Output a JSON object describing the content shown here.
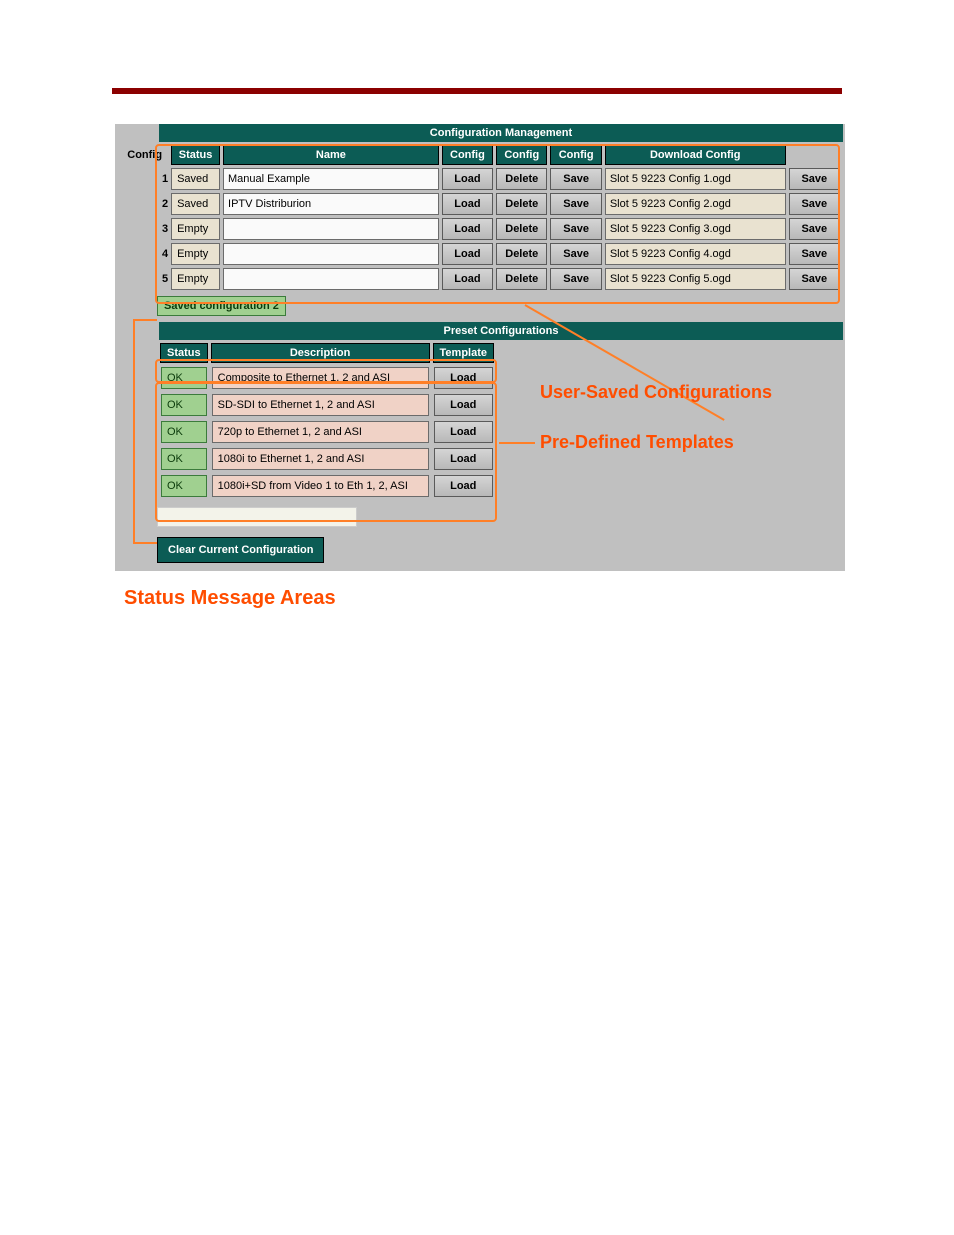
{
  "section_titles": {
    "config_mgmt": "Configuration Management",
    "preset": "Preset Configurations"
  },
  "config_headers": [
    "Config",
    "Status",
    "Name",
    "Config",
    "Config",
    "Config",
    "Download Config"
  ],
  "config_rows": [
    {
      "num": "1",
      "status": "Saved",
      "name": "Manual Example",
      "dl": "Slot 5 9223 Config 1.ogd"
    },
    {
      "num": "2",
      "status": "Saved",
      "name": "IPTV Distriburion",
      "dl": "Slot 5 9223 Config 2.ogd"
    },
    {
      "num": "3",
      "status": "Empty",
      "name": "",
      "dl": "Slot 5 9223 Config 3.ogd"
    },
    {
      "num": "4",
      "status": "Empty",
      "name": "",
      "dl": "Slot 5 9223 Config 4.ogd"
    },
    {
      "num": "5",
      "status": "Empty",
      "name": "",
      "dl": "Slot 5 9223 Config 5.ogd"
    }
  ],
  "config_btn_labels": {
    "load": "Load",
    "delete": "Delete",
    "save": "Save"
  },
  "status_msg": "Saved configuration 2",
  "preset_headers": [
    "Status",
    "Description",
    "Template"
  ],
  "preset_rows": [
    {
      "status": "OK",
      "desc": "Composite to Ethernet 1, 2 and ASI"
    },
    {
      "status": "OK",
      "desc": "SD-SDI to Ethernet 1, 2 and ASI"
    },
    {
      "status": "OK",
      "desc": "720p to Ethernet 1, 2 and ASI"
    },
    {
      "status": "OK",
      "desc": "1080i to Ethernet 1, 2 and ASI"
    },
    {
      "status": "OK",
      "desc": "1080i+SD from Video 1 to Eth 1, 2, ASI"
    }
  ],
  "preset_btn": "Load",
  "clear_btn": "Clear Current Configuration",
  "callouts": {
    "user_saved": "User-Saved Configurations",
    "predefined": "Pre-Defined Templates",
    "status_area": "Status Message Areas"
  }
}
